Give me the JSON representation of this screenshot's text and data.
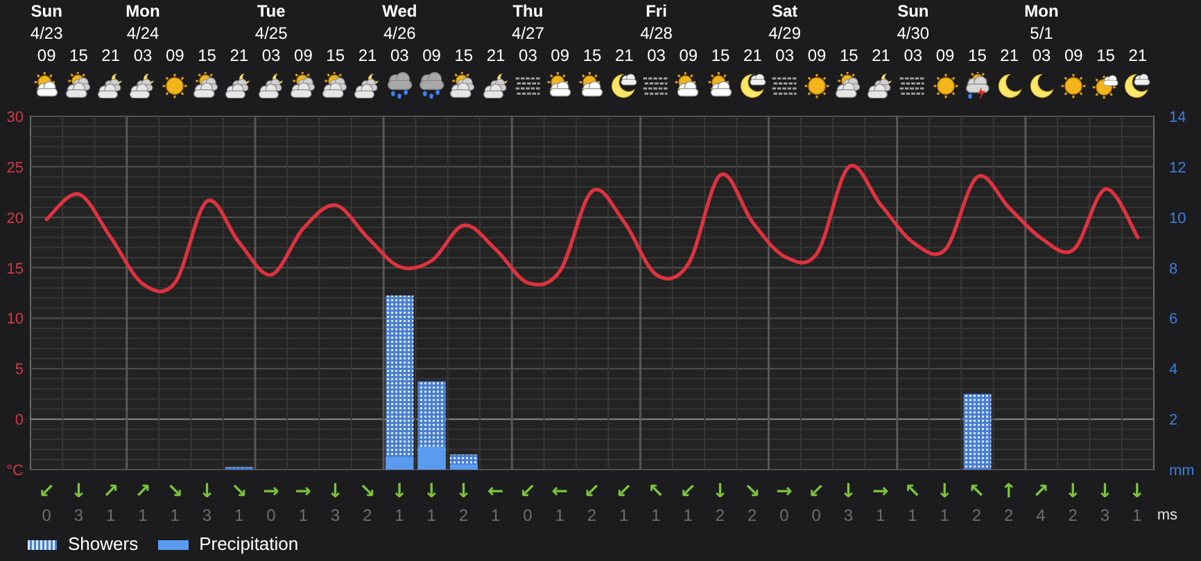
{
  "days": [
    {
      "name": "Sun",
      "date": "4/23",
      "slots": [
        {
          "hour": "09",
          "kind": "sun_cloud",
          "arrow": "↙",
          "speed": "0"
        },
        {
          "hour": "15",
          "kind": "sun_clouds",
          "arrow": "↓",
          "speed": "3"
        },
        {
          "hour": "21",
          "kind": "moon_clouds",
          "arrow": "↗",
          "speed": "1"
        }
      ]
    },
    {
      "name": "Mon",
      "date": "4/24",
      "slots": [
        {
          "hour": "03",
          "kind": "moon_clouds",
          "arrow": "↗",
          "speed": "1"
        },
        {
          "hour": "09",
          "kind": "sun",
          "arrow": "↘",
          "speed": "1"
        },
        {
          "hour": "15",
          "kind": "sun_clouds",
          "arrow": "↓",
          "speed": "3"
        },
        {
          "hour": "21",
          "kind": "moon_clouds",
          "arrow": "↘",
          "speed": "1"
        }
      ]
    },
    {
      "name": "Tue",
      "date": "4/25",
      "slots": [
        {
          "hour": "03",
          "kind": "moon_clouds",
          "arrow": "→",
          "speed": "0"
        },
        {
          "hour": "09",
          "kind": "sun_clouds",
          "arrow": "→",
          "speed": "1"
        },
        {
          "hour": "15",
          "kind": "sun_clouds",
          "arrow": "↓",
          "speed": "3"
        },
        {
          "hour": "21",
          "kind": "moon_clouds",
          "arrow": "↘",
          "speed": "2"
        }
      ]
    },
    {
      "name": "Wed",
      "date": "4/26",
      "slots": [
        {
          "hour": "03",
          "kind": "rain",
          "arrow": "↓",
          "speed": "1"
        },
        {
          "hour": "09",
          "kind": "rain",
          "arrow": "↓",
          "speed": "1"
        },
        {
          "hour": "15",
          "kind": "sun_clouds",
          "arrow": "↓",
          "speed": "2"
        },
        {
          "hour": "21",
          "kind": "moon_clouds",
          "arrow": "←",
          "speed": "1"
        }
      ]
    },
    {
      "name": "Thu",
      "date": "4/27",
      "slots": [
        {
          "hour": "03",
          "kind": "fog",
          "arrow": "↙",
          "speed": "0"
        },
        {
          "hour": "09",
          "kind": "sun_cloud",
          "arrow": "←",
          "speed": "1"
        },
        {
          "hour": "15",
          "kind": "sun_cloud",
          "arrow": "↙",
          "speed": "2"
        },
        {
          "hour": "21",
          "kind": "moon_cloud",
          "arrow": "↙",
          "speed": "1"
        }
      ]
    },
    {
      "name": "Fri",
      "date": "4/28",
      "slots": [
        {
          "hour": "03",
          "kind": "fog",
          "arrow": "↖",
          "speed": "1"
        },
        {
          "hour": "09",
          "kind": "sun_cloud",
          "arrow": "↙",
          "speed": "1"
        },
        {
          "hour": "15",
          "kind": "sun_cloud",
          "arrow": "↓",
          "speed": "2"
        },
        {
          "hour": "21",
          "kind": "moon_cloud",
          "arrow": "↘",
          "speed": "2"
        }
      ]
    },
    {
      "name": "Sat",
      "date": "4/29",
      "slots": [
        {
          "hour": "03",
          "kind": "fog",
          "arrow": "→",
          "speed": "0"
        },
        {
          "hour": "09",
          "kind": "sun",
          "arrow": "↙",
          "speed": "0"
        },
        {
          "hour": "15",
          "kind": "sun_clouds",
          "arrow": "↓",
          "speed": "3"
        },
        {
          "hour": "21",
          "kind": "moon_clouds",
          "arrow": "→",
          "speed": "1"
        }
      ]
    },
    {
      "name": "Sun",
      "date": "4/30",
      "slots": [
        {
          "hour": "03",
          "kind": "fog",
          "arrow": "↖",
          "speed": "1"
        },
        {
          "hour": "09",
          "kind": "sun",
          "arrow": "↓",
          "speed": "1"
        },
        {
          "hour": "15",
          "kind": "storm",
          "arrow": "↖",
          "speed": "2"
        },
        {
          "hour": "21",
          "kind": "moon",
          "arrow": "↑",
          "speed": "2"
        }
      ]
    },
    {
      "name": "Mon",
      "date": "5/1",
      "slots": [
        {
          "hour": "03",
          "kind": "moon",
          "arrow": "↗",
          "speed": "4"
        },
        {
          "hour": "09",
          "kind": "sun",
          "arrow": "↓",
          "speed": "2"
        },
        {
          "hour": "15",
          "kind": "sun_small_cloud",
          "arrow": "↓",
          "speed": "3"
        },
        {
          "hour": "21",
          "kind": "moon_cloud",
          "arrow": "↓",
          "speed": "1"
        }
      ]
    }
  ],
  "chart_data": {
    "type": "line",
    "grid": true,
    "ylim": [
      -5,
      30
    ],
    "yticks": [
      {
        "value": -5,
        "label": "°C"
      },
      0,
      5,
      10,
      15,
      20,
      25,
      30
    ],
    "series": [
      {
        "color": "#e0323f",
        "values": [
          19.8,
          22.3,
          18,
          13.4,
          13.5,
          21.6,
          17.5,
          14.3,
          18.9,
          21.2,
          18,
          15.1,
          15.7,
          19.2,
          16.8,
          13.5,
          14.7,
          22.6,
          19.5,
          14.3,
          15.4,
          24.2,
          19.5,
          16.1,
          16.4,
          25,
          21.2,
          17.5,
          16.8,
          24,
          20.9,
          17.9,
          16.8,
          22.8,
          18
        ]
      },
      {
        "name": "Showers",
        "axis": "y2",
        "type": "bar",
        "color": "#4a7fd0",
        "values": [
          null,
          null,
          null,
          null,
          null,
          null,
          0.1,
          null,
          null,
          null,
          null,
          6.9,
          3.5,
          0.6,
          null,
          null,
          null,
          null,
          null,
          null,
          null,
          null,
          null,
          null,
          null,
          null,
          null,
          null,
          null,
          3.0,
          null,
          null,
          null,
          null,
          null
        ]
      },
      {
        "name": "Precipitation",
        "axis": "y2",
        "type": "bar",
        "color": "#5b9bef",
        "values": [
          null,
          null,
          null,
          null,
          null,
          null,
          null,
          null,
          null,
          null,
          null,
          0.5,
          0.9,
          0.2,
          null,
          null,
          null,
          null,
          null,
          null,
          null,
          null,
          null,
          null,
          null,
          null,
          null,
          null,
          null,
          null,
          null,
          null,
          null,
          null,
          null
        ]
      }
    ],
    "y2lim": [
      0,
      14
    ],
    "y2ticks": [
      {
        "value": 0,
        "label": "mm"
      },
      2,
      4,
      6,
      8,
      10,
      12,
      14
    ]
  },
  "wind_unit": "ms"
}
